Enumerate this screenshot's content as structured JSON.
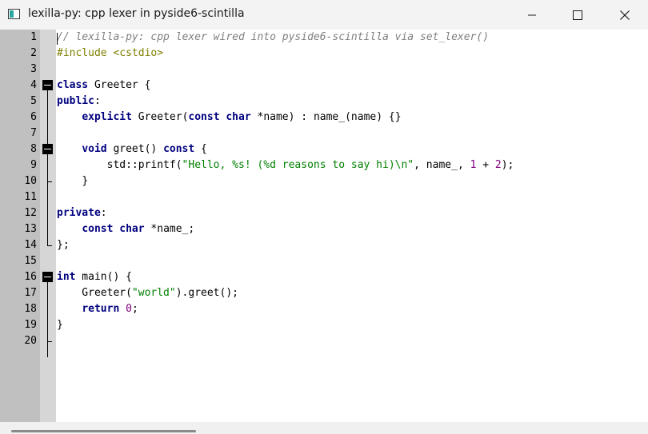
{
  "window": {
    "title": "lexilla-py: cpp lexer in pyside6-scintilla",
    "icon": "app-window-icon",
    "controls": [
      "minimize-icon",
      "maximize-icon",
      "close-icon"
    ]
  },
  "editor": {
    "lexer": "cpp",
    "line_numbers": [
      "1",
      "2",
      "3",
      "4",
      "5",
      "6",
      "7",
      "8",
      "9",
      "10",
      "11",
      "12",
      "13",
      "14",
      "15",
      "16",
      "17",
      "18",
      "19",
      "20"
    ],
    "fold_headers": [
      4,
      8,
      16
    ],
    "lines": [
      [
        [
          "comment",
          "// lexilla-py: cpp lexer wired into pyside6-scintilla via set_lexer()"
        ]
      ],
      [
        [
          "pre",
          "#include <cstdio>"
        ]
      ],
      [],
      [
        [
          "keyword",
          "class"
        ],
        [
          "plain",
          " Greeter "
        ],
        [
          "op",
          "{"
        ]
      ],
      [
        [
          "keyword",
          "public"
        ],
        [
          "op",
          ":"
        ]
      ],
      [
        [
          "plain",
          "    "
        ],
        [
          "keyword",
          "explicit"
        ],
        [
          "plain",
          " Greeter"
        ],
        [
          "op",
          "("
        ],
        [
          "keyword",
          "const"
        ],
        [
          "plain",
          " "
        ],
        [
          "keyword",
          "char"
        ],
        [
          "plain",
          " "
        ],
        [
          "op",
          "*"
        ],
        [
          "plain",
          "name"
        ],
        [
          "op",
          ")"
        ],
        [
          "plain",
          " "
        ],
        [
          "op",
          ":"
        ],
        [
          "plain",
          " name_"
        ],
        [
          "op",
          "("
        ],
        [
          "plain",
          "name"
        ],
        [
          "op",
          ")"
        ],
        [
          "plain",
          " "
        ],
        [
          "op",
          "{}"
        ]
      ],
      [],
      [
        [
          "plain",
          "    "
        ],
        [
          "keyword",
          "void"
        ],
        [
          "plain",
          " greet"
        ],
        [
          "op",
          "()"
        ],
        [
          "plain",
          " "
        ],
        [
          "keyword",
          "const"
        ],
        [
          "plain",
          " "
        ],
        [
          "op",
          "{"
        ]
      ],
      [
        [
          "plain",
          "        std"
        ],
        [
          "op",
          "::"
        ],
        [
          "plain",
          "printf"
        ],
        [
          "op",
          "("
        ],
        [
          "string",
          "\"Hello, %s! (%d reasons to say hi)\\n\""
        ],
        [
          "op",
          ","
        ],
        [
          "plain",
          " name_"
        ],
        [
          "op",
          ","
        ],
        [
          "plain",
          " "
        ],
        [
          "number",
          "1"
        ],
        [
          "plain",
          " "
        ],
        [
          "op",
          "+"
        ],
        [
          "plain",
          " "
        ],
        [
          "number",
          "2"
        ],
        [
          "op",
          ");"
        ]
      ],
      [
        [
          "plain",
          "    "
        ],
        [
          "op",
          "}"
        ]
      ],
      [],
      [
        [
          "keyword",
          "private"
        ],
        [
          "op",
          ":"
        ]
      ],
      [
        [
          "plain",
          "    "
        ],
        [
          "keyword",
          "const"
        ],
        [
          "plain",
          " "
        ],
        [
          "keyword",
          "char"
        ],
        [
          "plain",
          " "
        ],
        [
          "op",
          "*"
        ],
        [
          "plain",
          "name_"
        ],
        [
          "op",
          ";"
        ]
      ],
      [
        [
          "op",
          "};"
        ]
      ],
      [],
      [
        [
          "keyword",
          "int"
        ],
        [
          "plain",
          " main"
        ],
        [
          "op",
          "()"
        ],
        [
          "plain",
          " "
        ],
        [
          "op",
          "{"
        ]
      ],
      [
        [
          "plain",
          "    Greeter"
        ],
        [
          "op",
          "("
        ],
        [
          "string",
          "\"world\""
        ],
        [
          "op",
          ")."
        ],
        [
          "plain",
          "greet"
        ],
        [
          "op",
          "();"
        ]
      ],
      [
        [
          "plain",
          "    "
        ],
        [
          "keyword",
          "return"
        ],
        [
          "plain",
          " "
        ],
        [
          "number",
          "0"
        ],
        [
          "op",
          ";"
        ]
      ],
      [
        [
          "op",
          "}"
        ]
      ],
      []
    ]
  },
  "colors": {
    "line_number_margin": "#c0c0c0",
    "fold_margin": "#d6d6d6",
    "comment": "#7f7f7f",
    "preprocessor": "#7f7f00",
    "keyword": "#00007f",
    "string": "#007f00",
    "number": "#7f007f"
  }
}
